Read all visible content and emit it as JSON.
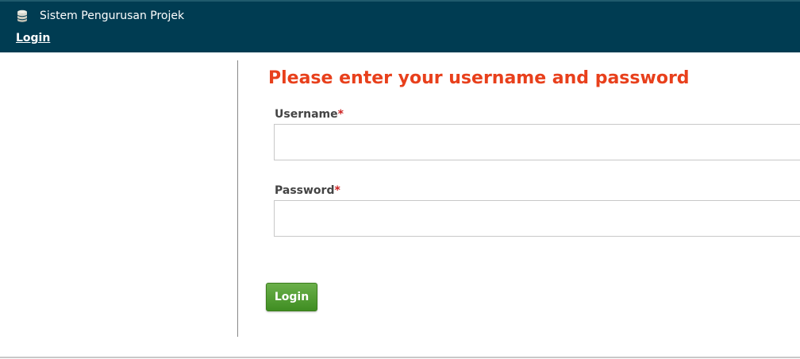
{
  "header": {
    "title": "Sistem Pengurusan Projek",
    "icon": "database-stack-icon",
    "nav_login": "Login"
  },
  "form": {
    "heading": "Please enter your username and password",
    "username_label": "Username",
    "password_label": "Password",
    "required_marker": "*",
    "username_value": "",
    "password_value": "",
    "submit_label": "Login"
  },
  "colors": {
    "header_bg": "#003c52",
    "heading": "#e8401c",
    "required": "#cc2222",
    "button": "#4e9a2e"
  }
}
